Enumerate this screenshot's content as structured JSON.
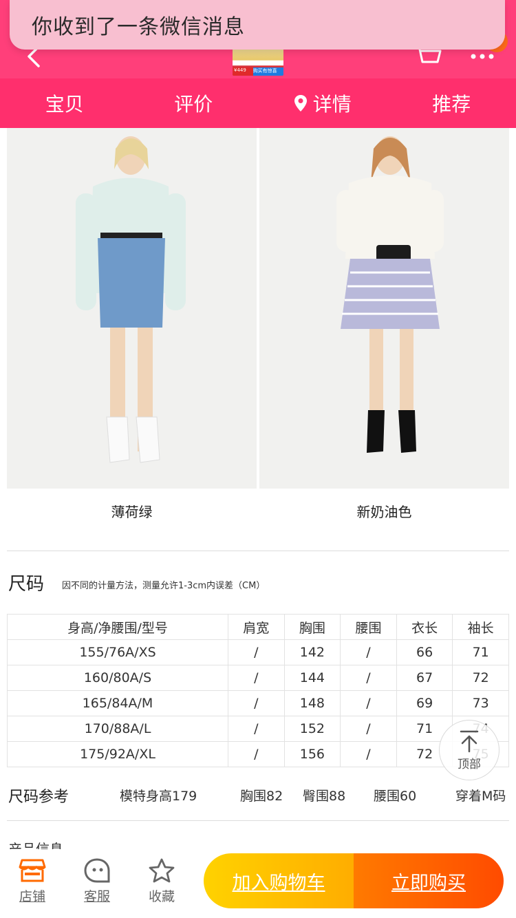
{
  "notification": {
    "text": "你收到了一条微信消息"
  },
  "header": {
    "thumbnail_tag_price": "¥449",
    "thumbnail_tag_promo": "购买有惊喜"
  },
  "tabs": [
    {
      "label": "宝贝"
    },
    {
      "label": "评价"
    },
    {
      "label": "详情",
      "icon": "location-pin-icon"
    },
    {
      "label": "推荐"
    }
  ],
  "products": [
    {
      "color_name": "薄荷绿"
    },
    {
      "color_name": "新奶油色"
    }
  ],
  "size_section": {
    "title": "尺码",
    "note": "因不同的计量方法，测量允许1-3cm内误差（CM）",
    "columns": [
      "身高/净腰围/型号",
      "肩宽",
      "胸围",
      "腰围",
      "衣长",
      "袖长"
    ],
    "rows": [
      [
        "155/76A/XS",
        "/",
        "142",
        "/",
        "66",
        "71"
      ],
      [
        "160/80A/S",
        "/",
        "144",
        "/",
        "67",
        "72"
      ],
      [
        "165/84A/M",
        "/",
        "148",
        "/",
        "69",
        "73"
      ],
      [
        "170/88A/L",
        "/",
        "152",
        "/",
        "71",
        "74"
      ],
      [
        "175/92A/XL",
        "/",
        "156",
        "/",
        "72",
        "75"
      ]
    ]
  },
  "size_reference": {
    "title": "尺码参考",
    "model_height": "模特身高179",
    "bust": "胸围82",
    "hip": "臀围88",
    "waist": "腰围60",
    "wearing": "穿着M码"
  },
  "cutoff_text": "产品信息",
  "back_to_top": {
    "label": "顶部"
  },
  "bottom_bar": {
    "store_label": "店铺",
    "service_label": "客服",
    "favorite_label": "收藏",
    "add_to_cart_label": "加入购物车",
    "buy_now_label": "立即购买"
  },
  "colors": {
    "header_pink": "#ff3f7a",
    "tab_pink": "#ff2f6d",
    "cart_yellow": "#ffc000",
    "buy_orange": "#ff5a00",
    "store_orange": "#ff6a00"
  }
}
